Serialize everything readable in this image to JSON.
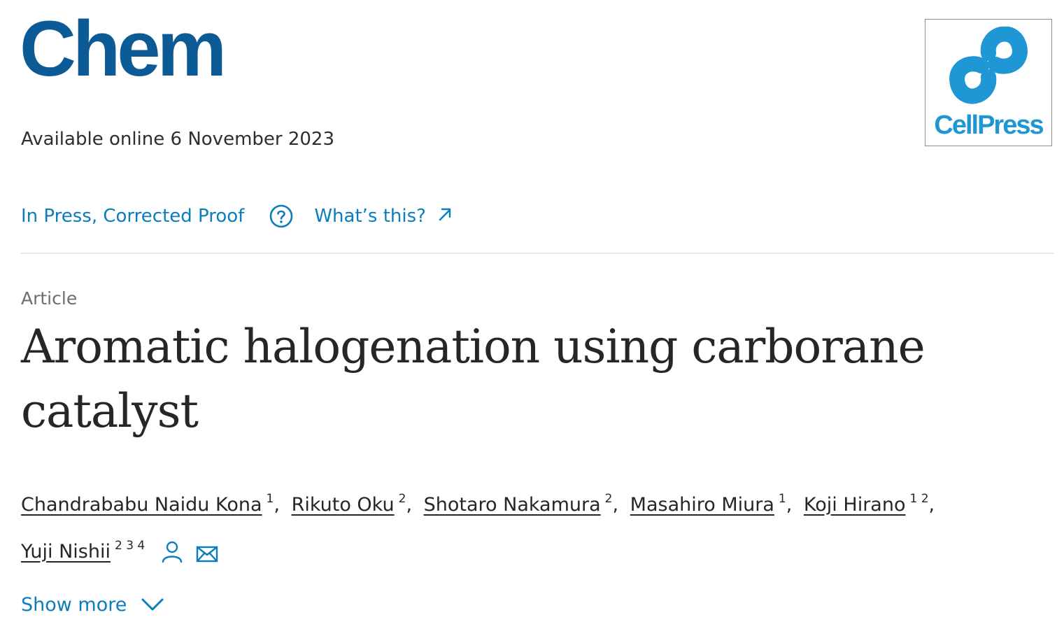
{
  "header": {
    "journal_title": "Chem",
    "publisher_logo_text": "CellPress"
  },
  "meta": {
    "available_online": "Available online 6 November 2023",
    "status_label": "In Press, Corrected Proof",
    "whats_this_label": "What’s this?"
  },
  "article": {
    "type": "Article",
    "title": "Aromatic halogenation using carborane catalyst",
    "authors": [
      {
        "name": "Chandrababu Naidu Kona",
        "affiliations": "1"
      },
      {
        "name": "Rikuto Oku",
        "affiliations": "2"
      },
      {
        "name": "Shotaro Nakamura",
        "affiliations": "2"
      },
      {
        "name": "Masahiro Miura",
        "affiliations": "1"
      },
      {
        "name": "Koji Hirano",
        "affiliations": "1 2"
      },
      {
        "name": "Yuji Nishii",
        "affiliations": "2 3 4"
      }
    ],
    "show_more_label": "Show more"
  },
  "colors": {
    "brand": "#0c5b96",
    "link": "#0c7dbb",
    "cellpress": "#1f97d4"
  },
  "icons": {
    "help": "question-circle-icon",
    "external": "external-arrow-icon",
    "person": "person-icon",
    "email": "envelope-icon",
    "chevron": "chevron-down-icon"
  }
}
